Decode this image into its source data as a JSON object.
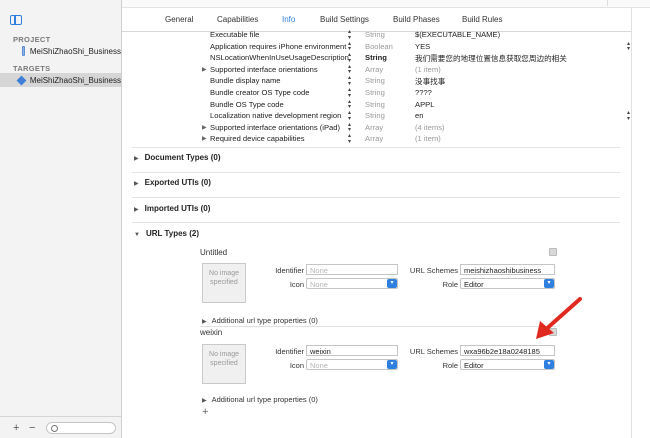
{
  "sidebar": {
    "project_header": "PROJECT",
    "project_item": "MeiShiZhaoShi_Business",
    "targets_header": "TARGETS",
    "target_item": "MeiShiZhaoShi_Business",
    "add": "+",
    "remove": "−"
  },
  "tabs": [
    "General",
    "Capabilities",
    "Info",
    "Build Settings",
    "Build Phases",
    "Build Rules"
  ],
  "active_tab": "Info",
  "plist_rows": [
    {
      "key": "Executable file",
      "type": "String",
      "value": "$(EXECUTABLE_NAME)",
      "expand": false
    },
    {
      "key": "Application requires iPhone environment",
      "type": "Boolean",
      "value": "YES",
      "expand": false,
      "value_stepper": true
    },
    {
      "key": "NSLocationWhenInUseUsageDescription",
      "type": "String",
      "value": "我们需要您的地理位置信息获取您周边的相关",
      "expand": false,
      "type_bold": true
    },
    {
      "key": "Supported interface orientations",
      "type": "Array",
      "value": "(1 item)",
      "expand": true
    },
    {
      "key": "Bundle display name",
      "type": "String",
      "value": "没事找事",
      "expand": false
    },
    {
      "key": "Bundle creator OS Type code",
      "type": "String",
      "value": "????",
      "expand": false
    },
    {
      "key": "Bundle OS Type code",
      "type": "String",
      "value": "APPL",
      "expand": false
    },
    {
      "key": "Localization native development region",
      "type": "String",
      "value": "en",
      "expand": false,
      "value_stepper": true
    },
    {
      "key": "Supported interface orientations (iPad)",
      "type": "Array",
      "value": "(4 items)",
      "expand": true
    },
    {
      "key": "Required device capabilities",
      "type": "Array",
      "value": "(1 item)",
      "expand": true
    }
  ],
  "sections": {
    "document_types": "Document Types (0)",
    "exported_utis": "Exported UTIs (0)",
    "imported_utis": "Imported UTIs (0)",
    "url_types": "URL Types (2)"
  },
  "url_types": [
    {
      "title": "Untitled",
      "image_text": "No image specified",
      "identifier_label": "Identifier",
      "identifier_value": "",
      "identifier_placeholder": "None",
      "icon_label": "Icon",
      "icon_value": "None",
      "schemes_label": "URL Schemes",
      "schemes_value": "meishizhaoshibusiness",
      "role_label": "Role",
      "role_value": "Editor",
      "additional": "Additional url type properties (0)"
    },
    {
      "title": "weixin",
      "image_text": "No image specified",
      "identifier_label": "Identifier",
      "identifier_value": "weixin",
      "icon_label": "Icon",
      "icon_value": "None",
      "schemes_label": "URL Schemes",
      "schemes_value": "wxa96b2e18a0248185",
      "role_label": "Role",
      "role_value": "Editor",
      "additional": "Additional url type properties (0)"
    }
  ],
  "add_url_type": "+",
  "colors": {
    "accent": "#2f7fe0",
    "annotation_arrow": "#e02a1f"
  }
}
